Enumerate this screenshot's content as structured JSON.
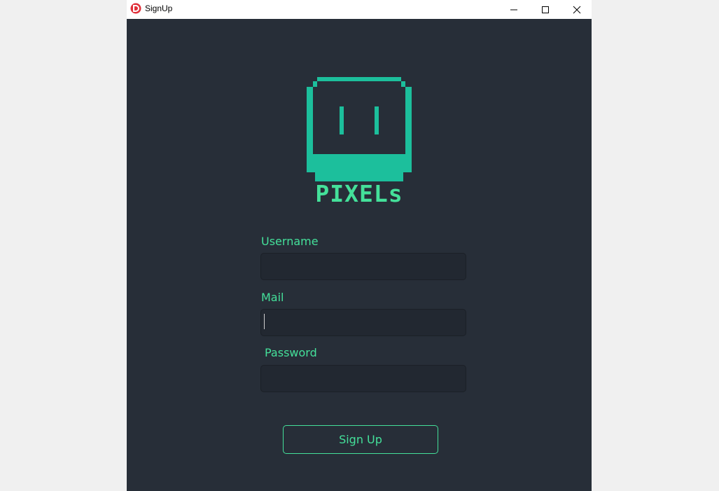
{
  "window": {
    "title": "SignUp"
  },
  "brand": {
    "name": "PIXELs"
  },
  "form": {
    "username_label": "Username",
    "username_value": "",
    "mail_label": "Mail",
    "mail_value": "",
    "password_label": "Password",
    "password_value": "",
    "signup_label": "Sign Up"
  },
  "colors": {
    "background": "#272e38",
    "accent": "#44e09a",
    "logo": "#1cbf9c",
    "field": "#222831"
  }
}
